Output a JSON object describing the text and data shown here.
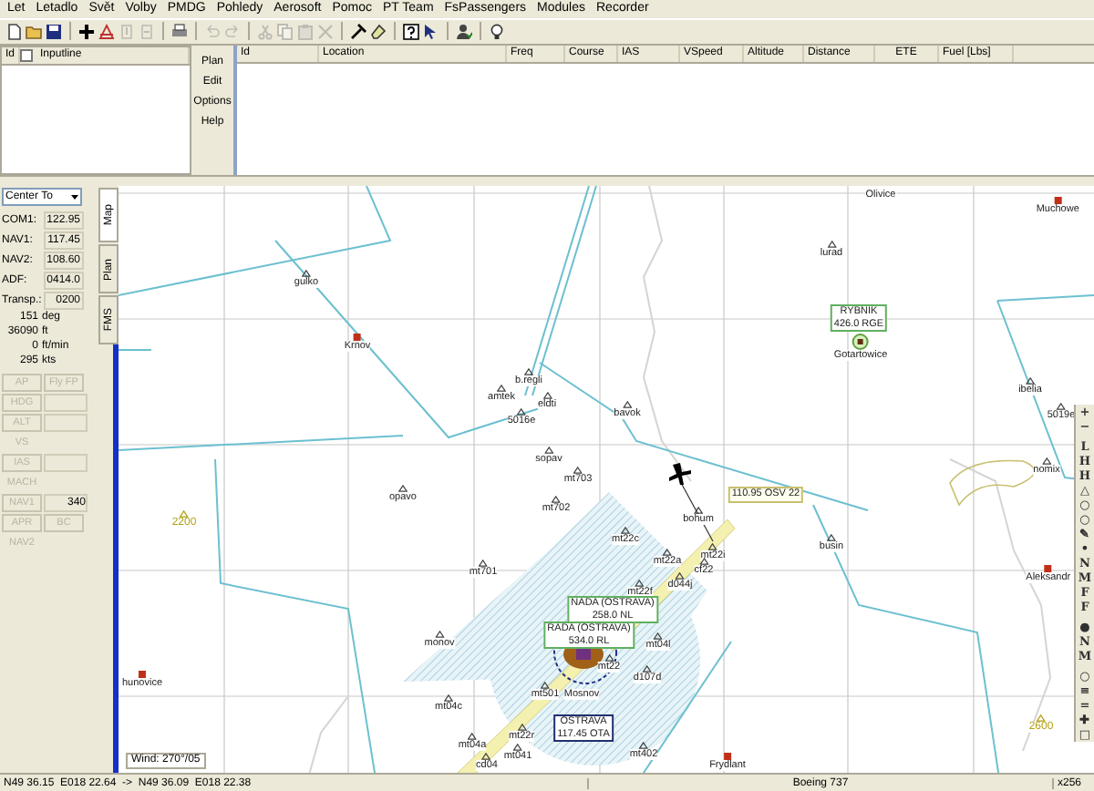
{
  "menu": [
    "Let",
    "Letadlo",
    "Svět",
    "Volby",
    "PMDG",
    "Pohledy",
    "Aerosoft",
    "Pomoc",
    "PT Team",
    "FsPassengers",
    "Modules",
    "Recorder"
  ],
  "toolbar": [
    {
      "kind": "new",
      "disabled": false
    },
    {
      "kind": "open",
      "disabled": false
    },
    {
      "kind": "save",
      "disabled": false
    },
    {
      "kind": "sep"
    },
    {
      "kind": "add",
      "disabled": false
    },
    {
      "kind": "aircraft",
      "disabled": false
    },
    {
      "kind": "up",
      "disabled": true
    },
    {
      "kind": "down",
      "disabled": true
    },
    {
      "kind": "sep"
    },
    {
      "kind": "print",
      "disabled": false
    },
    {
      "kind": "sep"
    },
    {
      "kind": "undo",
      "disabled": true
    },
    {
      "kind": "redo",
      "disabled": true
    },
    {
      "kind": "sep"
    },
    {
      "kind": "cut",
      "disabled": true
    },
    {
      "kind": "copy",
      "disabled": true
    },
    {
      "kind": "paste",
      "disabled": true
    },
    {
      "kind": "delete",
      "disabled": true
    },
    {
      "kind": "sep"
    },
    {
      "kind": "hammer",
      "disabled": false
    },
    {
      "kind": "eraser",
      "disabled": false
    },
    {
      "kind": "sep"
    },
    {
      "kind": "help",
      "disabled": false
    },
    {
      "kind": "whatsthis",
      "disabled": false
    },
    {
      "kind": "sep"
    },
    {
      "kind": "user",
      "disabled": false
    },
    {
      "kind": "sep"
    },
    {
      "kind": "bulb",
      "disabled": false
    }
  ],
  "waypoint_list": {
    "columns": [
      "Id",
      "Inputline"
    ],
    "checked": false
  },
  "plan_menu": [
    "Plan",
    "Edit",
    "Options",
    "Help"
  ],
  "flight_plan": {
    "columns": [
      "Id",
      "Location",
      "Freq",
      "Course",
      "IAS",
      "VSpeed",
      "Altitude",
      "Distance",
      "ETE",
      "Fuel [Lbs]"
    ]
  },
  "radio": {
    "center_to": "Center To",
    "rows": [
      {
        "label": "COM1:",
        "value": "122.95"
      },
      {
        "label": "NAV1:",
        "value": "117.45"
      },
      {
        "label": "NAV2:",
        "value": "108.60"
      },
      {
        "label": "ADF:",
        "value": "0414.0"
      },
      {
        "label": "Transp.:",
        "value": "0200"
      }
    ]
  },
  "readouts": [
    {
      "value": "151",
      "unit": "deg"
    },
    {
      "value": "36090",
      "unit": "ft"
    },
    {
      "value": "0",
      "unit": "ft/min"
    },
    {
      "value": "295",
      "unit": "kts"
    }
  ],
  "autopilot": [
    {
      "kind": "pair",
      "buttons": [
        {
          "label": "AP",
          "disabled": true
        },
        {
          "label": "Fly FP",
          "disabled": true
        }
      ]
    },
    {
      "kind": "field",
      "label": "HDG",
      "disabled": true
    },
    {
      "kind": "field",
      "label": "ALT",
      "disabled": true
    },
    {
      "kind": "single",
      "label": "VS",
      "disabled": true
    },
    {
      "kind": "field",
      "label": "IAS",
      "disabled": true
    },
    {
      "kind": "single",
      "label": "MACH",
      "disabled": true
    },
    {
      "kind": "field",
      "label": "NAV1",
      "disabled": true,
      "value": "340"
    },
    {
      "kind": "pair",
      "buttons": [
        {
          "label": "APR",
          "disabled": true
        },
        {
          "label": "BC",
          "disabled": true
        }
      ]
    },
    {
      "kind": "single",
      "label": "NAV2",
      "disabled": true
    }
  ],
  "view_tabs": [
    {
      "label": "Map",
      "selected": true
    },
    {
      "label": "Plan",
      "selected": false
    },
    {
      "label": "FMS",
      "selected": false
    }
  ],
  "map": {
    "places": [
      {
        "kind": "edge",
        "name": "Olivice"
      },
      {
        "kind": "waypoint",
        "name": "gulko"
      },
      {
        "kind": "town",
        "name": "Krnov"
      },
      {
        "kind": "town",
        "name": "Muchowe"
      },
      {
        "kind": "waypoint",
        "name": "lurad"
      },
      {
        "kind": "airport",
        "name": "Gotartowice"
      },
      {
        "kind": "waypoint",
        "name": "ibelia"
      },
      {
        "kind": "waypoint",
        "name": "5019e"
      },
      {
        "kind": "waypoint",
        "name": "amtek"
      },
      {
        "kind": "waypoint",
        "name": "b.regli"
      },
      {
        "kind": "waypoint",
        "name": "eldti"
      },
      {
        "kind": "waypoint",
        "name": "5016e"
      },
      {
        "kind": "waypoint",
        "name": "bavok"
      },
      {
        "kind": "waypoint",
        "name": "sopav"
      },
      {
        "kind": "waypoint",
        "name": "mt703"
      },
      {
        "kind": "waypoint",
        "name": "mt702"
      },
      {
        "kind": "waypoint",
        "name": "opavo"
      },
      {
        "kind": "waypoint",
        "name": "nomix"
      },
      {
        "kind": "waypoint",
        "name": "bohum"
      },
      {
        "kind": "waypoint",
        "name": "busin"
      },
      {
        "kind": "waypoint",
        "name": "mt701"
      },
      {
        "kind": "waypoint",
        "name": "mt22c"
      },
      {
        "kind": "waypoint",
        "name": "mt22a"
      },
      {
        "kind": "waypoint",
        "name": "mt22i"
      },
      {
        "kind": "waypoint",
        "name": "cf22"
      },
      {
        "kind": "waypoint",
        "name": "d044j"
      },
      {
        "kind": "waypoint",
        "name": "mt22f"
      },
      {
        "kind": "town",
        "name": "Aleksandr"
      },
      {
        "kind": "waypoint",
        "name": "monov"
      },
      {
        "kind": "waypoint",
        "name": "mt04l"
      },
      {
        "kind": "waypoint",
        "name": "mt22"
      },
      {
        "kind": "waypoint",
        "name": "d107d"
      },
      {
        "kind": "waypoint",
        "name": "mt501"
      },
      {
        "kind": "label",
        "name": "Mosnov"
      },
      {
        "kind": "waypoint",
        "name": "mt04c"
      },
      {
        "kind": "town",
        "name": "hunovice"
      },
      {
        "kind": "waypoint",
        "name": "mt22r"
      },
      {
        "kind": "waypoint",
        "name": "mt04a"
      },
      {
        "kind": "waypoint",
        "name": "mt041"
      },
      {
        "kind": "waypoint",
        "name": "cd04"
      },
      {
        "kind": "waypoint",
        "name": "mt402"
      },
      {
        "kind": "town",
        "name": "Frydlant"
      },
      {
        "kind": "altitude",
        "name": "2200"
      },
      {
        "kind": "altitude",
        "name": "2600"
      }
    ],
    "beacons": [
      {
        "kind": "ndb",
        "lines": [
          "RYBNIK",
          "426.0 RGE"
        ]
      },
      {
        "kind": "ils",
        "lines": [
          "110.95 OSV 22"
        ]
      },
      {
        "kind": "ndb",
        "lines": [
          "NADA (OSTRAVA)",
          "258.0 NL"
        ]
      },
      {
        "kind": "ndb",
        "lines": [
          "RADA (OSTRAVA)",
          "534.0 RL"
        ]
      },
      {
        "kind": "vor",
        "lines": [
          "OSTRAVA",
          "117.45 OTA"
        ]
      }
    ],
    "wind": "Wind: 270°/05",
    "tools": [
      "+",
      "−",
      "L",
      "H",
      "H",
      "△",
      "○",
      "○",
      "✎",
      "•",
      "N",
      "M",
      "F",
      "F",
      "●",
      "N",
      "M",
      "○",
      "≡",
      "=",
      "✚",
      "□"
    ]
  },
  "status_bar": {
    "position": "N49 36.15  E018 22.64  ->  N49 36.09  E018 22.38",
    "aircraft": "Boeing 737",
    "zoom": "x256"
  }
}
